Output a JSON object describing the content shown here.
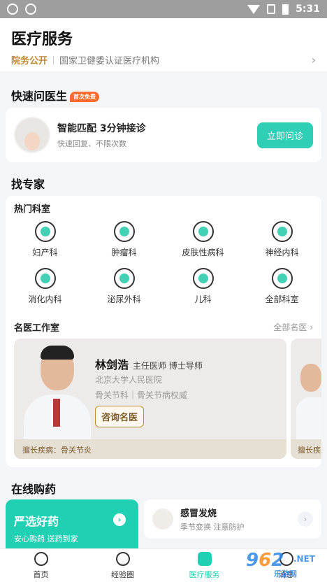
{
  "status_bar": {
    "time": "5:31"
  },
  "header": {
    "title": "医疗服务",
    "hospital_tag": "院务公开",
    "hospital_desc": "国家卫健委认证医疗机构"
  },
  "quick_ask": {
    "section_title": "快速问医生",
    "badge": "首次免费",
    "title": "智能匹配 3分钟接诊",
    "subtitle": "快速回复、不限次数",
    "button": "立即问诊"
  },
  "experts": {
    "section_title": "找专家",
    "hot_depts_title": "热门科室",
    "departments": [
      {
        "label": "妇产科",
        "icon": "uterus-icon"
      },
      {
        "label": "肿瘤科",
        "icon": "tumor-icon"
      },
      {
        "label": "皮肤性病科",
        "icon": "skin-icon"
      },
      {
        "label": "神经内科",
        "icon": "brain-icon"
      },
      {
        "label": "消化内科",
        "icon": "stomach-icon"
      },
      {
        "label": "泌尿外科",
        "icon": "kidney-icon"
      },
      {
        "label": "儿科",
        "icon": "pacifier-icon"
      },
      {
        "label": "全部科室",
        "icon": "all-depts-icon"
      }
    ],
    "famous_title": "名医工作室",
    "famous_more": "全部名医",
    "doctors": [
      {
        "name": "林剑浩",
        "title": "主任医师 博士导师",
        "hospital": "北京大学人民医院",
        "dept": "骨关节科｜骨关节病权威",
        "button": "咨询名医",
        "specialty": "擅长疾病：骨关节炎"
      },
      {
        "specialty": "擅长疾"
      }
    ]
  },
  "drugs": {
    "section_title": "在线购药",
    "promo_title": "严选好药",
    "promo_sub": "安心购药 送药到家",
    "item_title": "感冒发烧",
    "item_sub": "季节变换 注意防护"
  },
  "tabbar": [
    {
      "label": "首页",
      "active": false
    },
    {
      "label": "经验圈",
      "active": false
    },
    {
      "label": "医疗服务",
      "active": true
    },
    {
      "label": "消息",
      "active": false
    }
  ],
  "watermark": {
    "text": "962.NET",
    "sub": "乐游网"
  },
  "colors": {
    "accent": "#1fd0b2",
    "gold": "#c08a2e",
    "badge": "#ff6b2c"
  }
}
